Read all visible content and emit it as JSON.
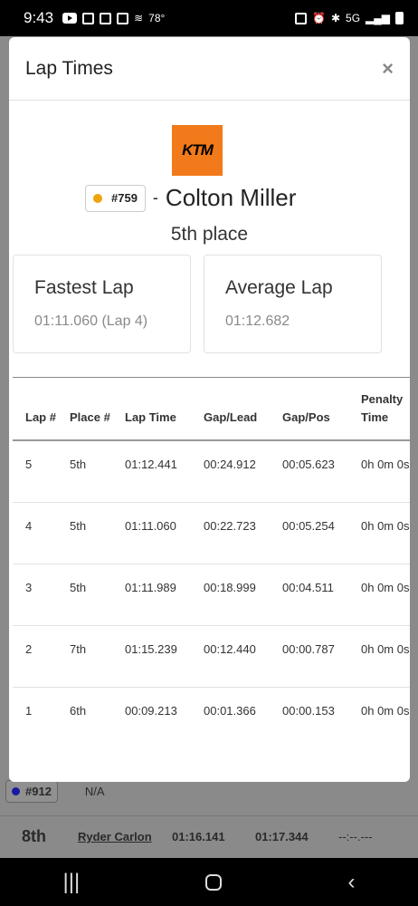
{
  "status_bar": {
    "time": "9:43",
    "temp": "78°",
    "network": "5G"
  },
  "background": {
    "row1": {
      "number": "#912",
      "value": "N/A"
    },
    "row2": {
      "place": "8th",
      "name": "Ryder Carlon",
      "t1": "01:16.141",
      "t2": "01:17.344",
      "t3": "--:--.---"
    }
  },
  "modal": {
    "title": "Lap Times",
    "close": "×",
    "logo_text": "KTM",
    "rider_number": "#759",
    "dash": "-",
    "rider_name": "Colton Miller",
    "place": "5th place",
    "fastest": {
      "title": "Fastest Lap",
      "value": "01:11.060 (Lap 4)"
    },
    "average": {
      "title": "Average Lap",
      "value": "01:12.682"
    },
    "table": {
      "headers": {
        "lap": "Lap #",
        "place": "Place #",
        "lap_time": "Lap Time",
        "gap_lead": "Gap/Lead",
        "gap_pos": "Gap/Pos",
        "penalty": "Penalty Time"
      },
      "rows": [
        {
          "lap": "5",
          "place": "5th",
          "lap_time": "01:12.441",
          "gap_lead": "00:24.912",
          "gap_pos": "00:05.623",
          "penalty": "0h 0m 0s"
        },
        {
          "lap": "4",
          "place": "5th",
          "lap_time": "01:11.060",
          "gap_lead": "00:22.723",
          "gap_pos": "00:05.254",
          "penalty": "0h 0m 0s"
        },
        {
          "lap": "3",
          "place": "5th",
          "lap_time": "01:11.989",
          "gap_lead": "00:18.999",
          "gap_pos": "00:04.511",
          "penalty": "0h 0m 0s"
        },
        {
          "lap": "2",
          "place": "7th",
          "lap_time": "01:15.239",
          "gap_lead": "00:12.440",
          "gap_pos": "00:00.787",
          "penalty": "0h 0m 0s"
        },
        {
          "lap": "1",
          "place": "6th",
          "lap_time": "00:09.213",
          "gap_lead": "00:01.366",
          "gap_pos": "00:00.153",
          "penalty": "0h 0m 0s"
        }
      ]
    }
  },
  "colors": {
    "brand": "#f27a1a",
    "rider_dot": "#f0a30a"
  }
}
